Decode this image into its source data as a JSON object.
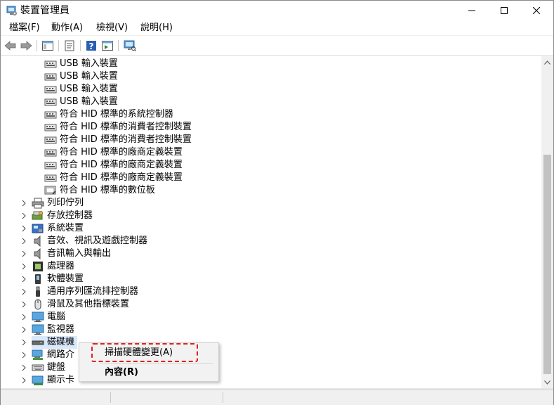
{
  "window": {
    "title": "裝置管理員"
  },
  "menu": {
    "file": "檔案(F)",
    "action": "動作(A)",
    "view": "檢視(V)",
    "help": "說明(H)"
  },
  "tree": {
    "children": [
      {
        "label": "USB 輸入裝置",
        "icon": "hid-device-icon"
      },
      {
        "label": "USB 輸入裝置",
        "icon": "hid-device-icon"
      },
      {
        "label": "USB 輸入裝置",
        "icon": "hid-device-icon"
      },
      {
        "label": "USB 輸入裝置",
        "icon": "hid-device-icon"
      },
      {
        "label": "符合 HID 標準的系統控制器",
        "icon": "hid-device-icon"
      },
      {
        "label": "符合 HID 標準的消費者控制裝置",
        "icon": "hid-device-icon"
      },
      {
        "label": "符合 HID 標準的消費者控制裝置",
        "icon": "hid-device-icon"
      },
      {
        "label": "符合 HID 標準的廠商定義裝置",
        "icon": "hid-device-icon"
      },
      {
        "label": "符合 HID 標準的廠商定義裝置",
        "icon": "hid-device-icon"
      },
      {
        "label": "符合 HID 標準的廠商定義裝置",
        "icon": "hid-device-icon"
      },
      {
        "label": "符合 HID 標準的數位板",
        "icon": "tablet-icon"
      }
    ],
    "categories": [
      {
        "label": "列印佇列",
        "icon": "printer-icon"
      },
      {
        "label": "存放控制器",
        "icon": "storage-controller-icon"
      },
      {
        "label": "系統裝置",
        "icon": "system-device-icon"
      },
      {
        "label": "音效、視訊及遊戲控制器",
        "icon": "speaker-icon"
      },
      {
        "label": "音訊輸入與輸出",
        "icon": "speaker-icon"
      },
      {
        "label": "處理器",
        "icon": "processor-icon"
      },
      {
        "label": "軟體裝置",
        "icon": "software-device-icon"
      },
      {
        "label": "通用序列匯流排控制器",
        "icon": "usb-icon"
      },
      {
        "label": "滑鼠及其他指標裝置",
        "icon": "mouse-icon"
      },
      {
        "label": "電腦",
        "icon": "computer-icon"
      },
      {
        "label": "監視器",
        "icon": "monitor-icon"
      },
      {
        "label": "磁碟機",
        "icon": "disk-drive-icon"
      },
      {
        "label": "網路介",
        "icon": "network-adapter-icon"
      },
      {
        "label": "鍵盤",
        "icon": "keyboard-icon"
      },
      {
        "label": "顯示卡",
        "icon": "display-adapter-icon"
      }
    ]
  },
  "context_menu": {
    "scan": "掃描硬體變更(A)",
    "properties": "內容(R)"
  },
  "colors": {
    "highlight": "#e02020",
    "selection": "#d9e8fb",
    "scrollbar_thumb": "#c2c2c2"
  }
}
